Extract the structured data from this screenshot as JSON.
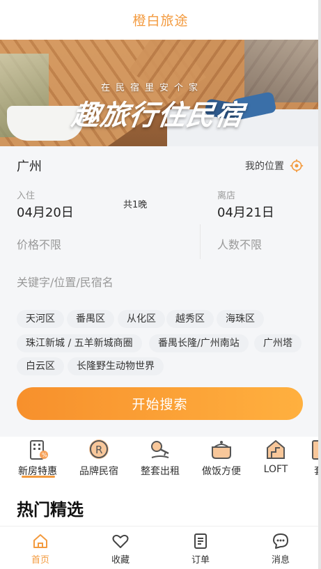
{
  "app": {
    "title": "橙白旅途"
  },
  "banner": {
    "subtitle": "在民宿里安个家",
    "headline": "趣旅行住民宿"
  },
  "search": {
    "city": "广州",
    "my_location": "我的位置",
    "checkin_label": "入住",
    "checkin_date": "04月20日",
    "nights": "共1晚",
    "checkout_label": "离店",
    "checkout_date": "04月21日",
    "price": "价格不限",
    "people": "人数不限",
    "keyword_placeholder": "关键字/位置/民宿名",
    "tags": [
      "天河区",
      "番禺区",
      "从化区",
      "越秀区",
      "海珠区",
      "珠江新城 / 五羊新城商圈",
      "番禺长隆/广州南站",
      "广州塔",
      "白云区",
      "长隆野生动物世界"
    ],
    "button": "开始搜索"
  },
  "categories": [
    {
      "label": "新房特惠",
      "icon": "building-discount-icon"
    },
    {
      "label": "品牌民宿",
      "icon": "registered-brand-icon"
    },
    {
      "label": "整套出租",
      "icon": "key-icon"
    },
    {
      "label": "做饭方便",
      "icon": "cooking-pot-icon"
    },
    {
      "label": "LOFT",
      "icon": "loft-house-icon"
    },
    {
      "label": "套",
      "icon": "suite-icon"
    }
  ],
  "section": {
    "hot_title": "热门精选"
  },
  "tabbar": [
    {
      "label": "首页",
      "icon": "home-icon"
    },
    {
      "label": "收藏",
      "icon": "heart-icon"
    },
    {
      "label": "订单",
      "icon": "order-icon"
    },
    {
      "label": "消息",
      "icon": "message-icon"
    }
  ],
  "colors": {
    "accent": "#f39a3e",
    "button_start": "#f7902c",
    "button_end": "#ffb03f",
    "tag_bg": "#eef0f3"
  }
}
